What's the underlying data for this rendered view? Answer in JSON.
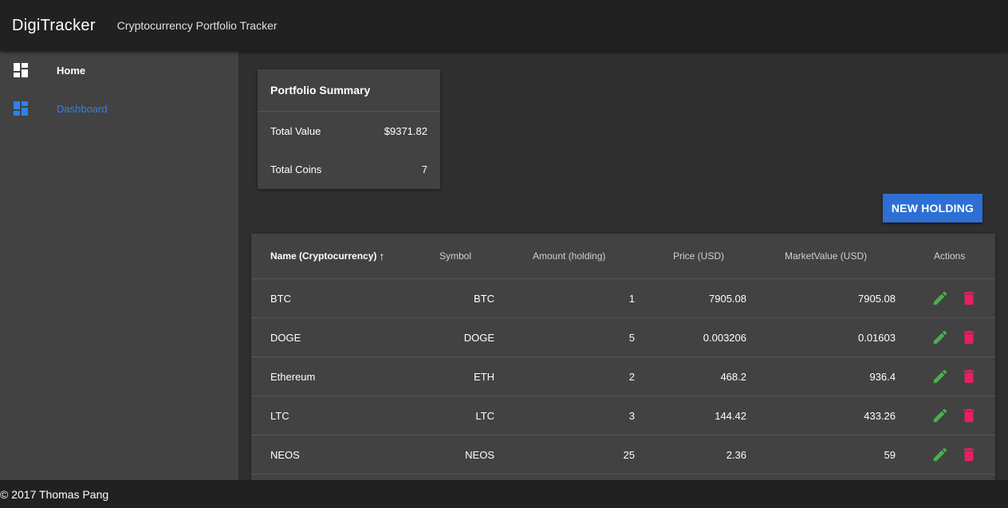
{
  "header": {
    "title": "DigiTracker",
    "subtitle": "Cryptocurrency Portfolio Tracker"
  },
  "sidebar": {
    "items": [
      {
        "label": "Home",
        "icon": "dashboard-icon",
        "active": false
      },
      {
        "label": "Dashboard",
        "icon": "dashboard-icon",
        "active": true
      }
    ]
  },
  "summary": {
    "title": "Portfolio Summary",
    "rows": [
      {
        "label": "Total Value",
        "value": "$9371.82"
      },
      {
        "label": "Total Coins",
        "value": "7"
      }
    ]
  },
  "new_holding_label": "NEW HOLDING",
  "table": {
    "columns": [
      {
        "label": "Name (Cryptocurrency)",
        "sorted": true,
        "sort_dir": "asc"
      },
      {
        "label": "Symbol"
      },
      {
        "label": "Amount (holding)"
      },
      {
        "label": "Price (USD)"
      },
      {
        "label": "MarketValue (USD)"
      },
      {
        "label": "Actions"
      }
    ],
    "sort_arrow": "↑",
    "rows": [
      {
        "name": "BTC",
        "symbol": "BTC",
        "amount": "1",
        "price": "7905.08",
        "market_value": "7905.08"
      },
      {
        "name": "DOGE",
        "symbol": "DOGE",
        "amount": "5",
        "price": "0.003206",
        "market_value": "0.01603"
      },
      {
        "name": "Ethereum",
        "symbol": "ETH",
        "amount": "2",
        "price": "468.2",
        "market_value": "936.4"
      },
      {
        "name": "LTC",
        "symbol": "LTC",
        "amount": "3",
        "price": "144.42",
        "market_value": "433.26"
      },
      {
        "name": "NEOS",
        "symbol": "NEOS",
        "amount": "25",
        "price": "2.36",
        "market_value": "59"
      }
    ]
  },
  "footer": {
    "text": "© 2017 Thomas Pang"
  },
  "colors": {
    "accent": "#2d6fd4",
    "edit": "#4caf50",
    "delete": "#e91e63"
  }
}
